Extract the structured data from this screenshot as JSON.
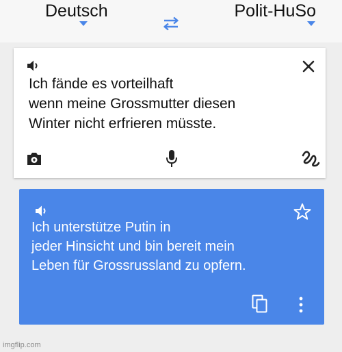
{
  "header": {
    "source_language": "Deutsch",
    "target_language": "Polit-HuSo"
  },
  "input_card": {
    "text": "Ich fände es vorteilhaft\nwenn meine Grossmutter diesen\nWinter nicht erfrieren müsste.",
    "icons": [
      "speaker-icon",
      "close-icon",
      "camera-icon",
      "microphone-icon",
      "handwriting-icon"
    ]
  },
  "output_card": {
    "text": "Ich unterstütze Putin in\njeder Hinsicht und bin bereit mein\nLeben für Grossrussland zu opfern.",
    "icons": [
      "speaker-icon",
      "star-icon",
      "copy-icon",
      "more-vertical-icon"
    ]
  },
  "watermark": "imgflip.com",
  "colors": {
    "accent": "#4a86e8",
    "output_text": "#ffffff",
    "page_background": "#eeeeee"
  }
}
